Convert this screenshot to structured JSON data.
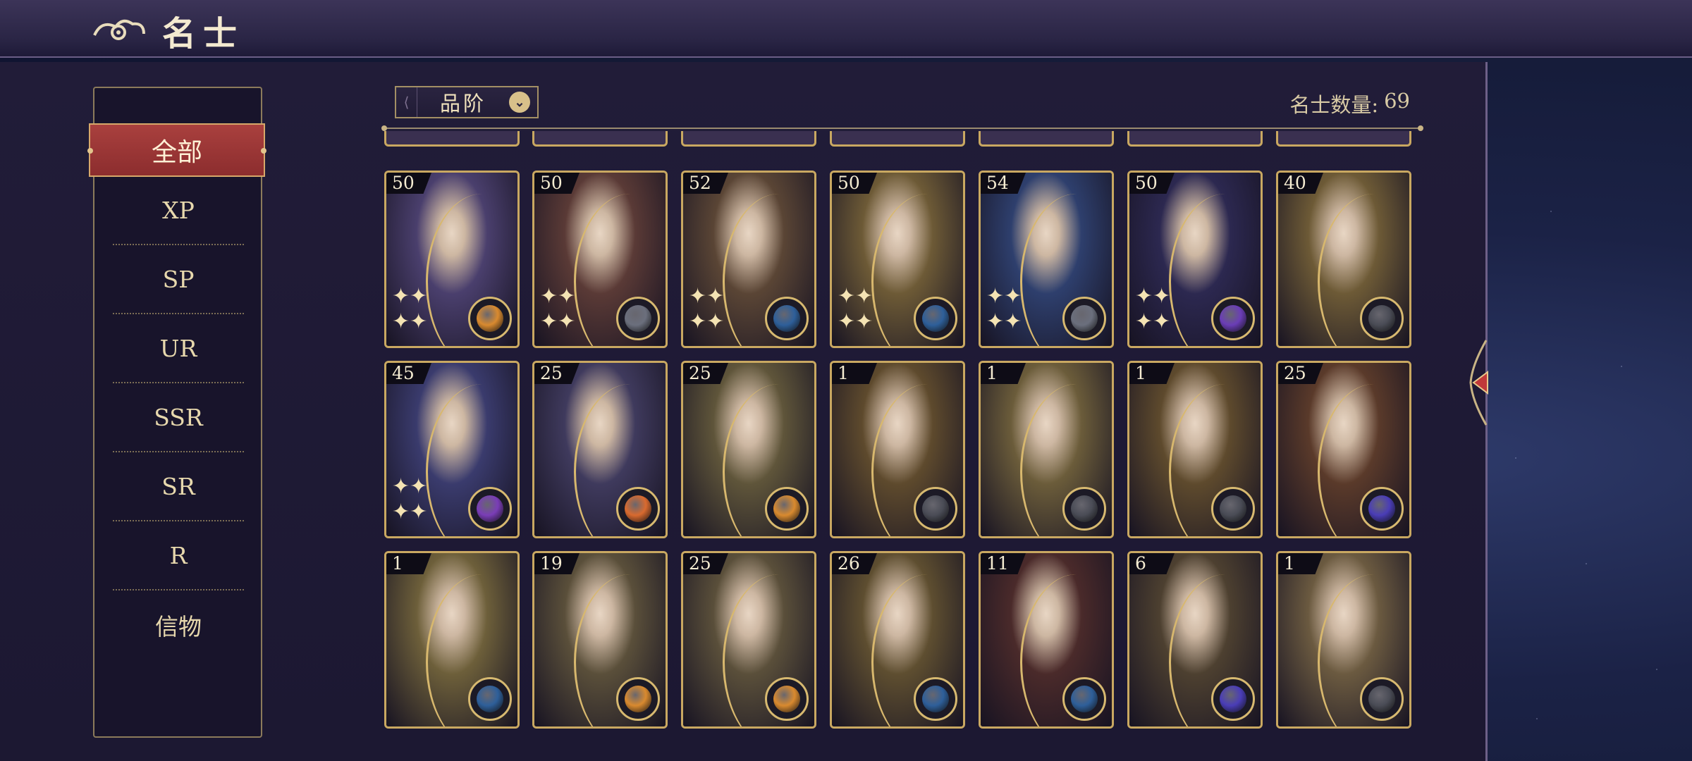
{
  "header": {
    "title": "名士",
    "logo_icon": "cloud-swirl-icon"
  },
  "filters": {
    "active": "全部",
    "items": [
      "XP",
      "SP",
      "UR",
      "SSR",
      "SR",
      "R",
      "信物"
    ]
  },
  "sort": {
    "label": "品阶"
  },
  "count": {
    "label": "名士数量:",
    "value": "69"
  },
  "cards": [
    {
      "level": "50",
      "frame": "#c9a861",
      "bg": "#4a3f6d",
      "emblem": "#d98a2f",
      "stars": true
    },
    {
      "level": "50",
      "frame": "#c9a861",
      "bg": "#5a3a36",
      "emblem": "#6b6f7d",
      "stars": true
    },
    {
      "level": "52",
      "frame": "#c9a861",
      "bg": "#5a4535",
      "emblem": "#2e5f9a",
      "stars": true
    },
    {
      "level": "50",
      "frame": "#c9a861",
      "bg": "#6d5a36",
      "emblem": "#2e5f9a",
      "stars": true
    },
    {
      "level": "54",
      "frame": "#c9a861",
      "bg": "#2e3f6d",
      "emblem": "#6b6f7d",
      "stars": true
    },
    {
      "level": "50",
      "frame": "#c9a861",
      "bg": "#2c2850",
      "emblem": "#6a3db7",
      "stars": true
    },
    {
      "level": "40",
      "frame": "#c9a861",
      "bg": "#6d5a36",
      "emblem": "#4a4c56",
      "stars": false
    },
    {
      "level": "45",
      "frame": "#c9a861",
      "bg": "#3a3b6d",
      "emblem": "#7a3db7",
      "stars": true
    },
    {
      "level": "25",
      "frame": "#c9a861",
      "bg": "#3f3a5d",
      "emblem": "#d96a2f",
      "stars": false
    },
    {
      "level": "25",
      "frame": "#c9a861",
      "bg": "#5f553a",
      "emblem": "#d98a2f",
      "stars": false
    },
    {
      "level": "1",
      "frame": "#c9a861",
      "bg": "#5e4a2d",
      "emblem": "#4a4c56",
      "stars": false
    },
    {
      "level": "1",
      "frame": "#c9a861",
      "bg": "#6b5c3a",
      "emblem": "#4a4c56",
      "stars": false
    },
    {
      "level": "1",
      "frame": "#c9a861",
      "bg": "#5e4a2d",
      "emblem": "#4a4c56",
      "stars": false
    },
    {
      "level": "25",
      "frame": "#c9a861",
      "bg": "#5a3a2a",
      "emblem": "#4a3db7",
      "stars": false
    },
    {
      "level": "1",
      "frame": "#c9a861",
      "bg": "#6d5f3a",
      "emblem": "#2e5f9a",
      "stars": false
    },
    {
      "level": "19",
      "frame": "#c9a861",
      "bg": "#5a4f3a",
      "emblem": "#d98a2f",
      "stars": false
    },
    {
      "level": "25",
      "frame": "#c9a861",
      "bg": "#5a4f3a",
      "emblem": "#d98a2f",
      "stars": false
    },
    {
      "level": "26",
      "frame": "#c9a861",
      "bg": "#5e4e30",
      "emblem": "#2e5f9a",
      "stars": false
    },
    {
      "level": "11",
      "frame": "#c9a861",
      "bg": "#4a2a2a",
      "emblem": "#2e5f9a",
      "stars": false
    },
    {
      "level": "6",
      "frame": "#c9a861",
      "bg": "#4d4030",
      "emblem": "#4a3db7",
      "stars": false
    },
    {
      "level": "1",
      "frame": "#c9a861",
      "bg": "#6b5a40",
      "emblem": "#4a4c56",
      "stars": false
    }
  ]
}
